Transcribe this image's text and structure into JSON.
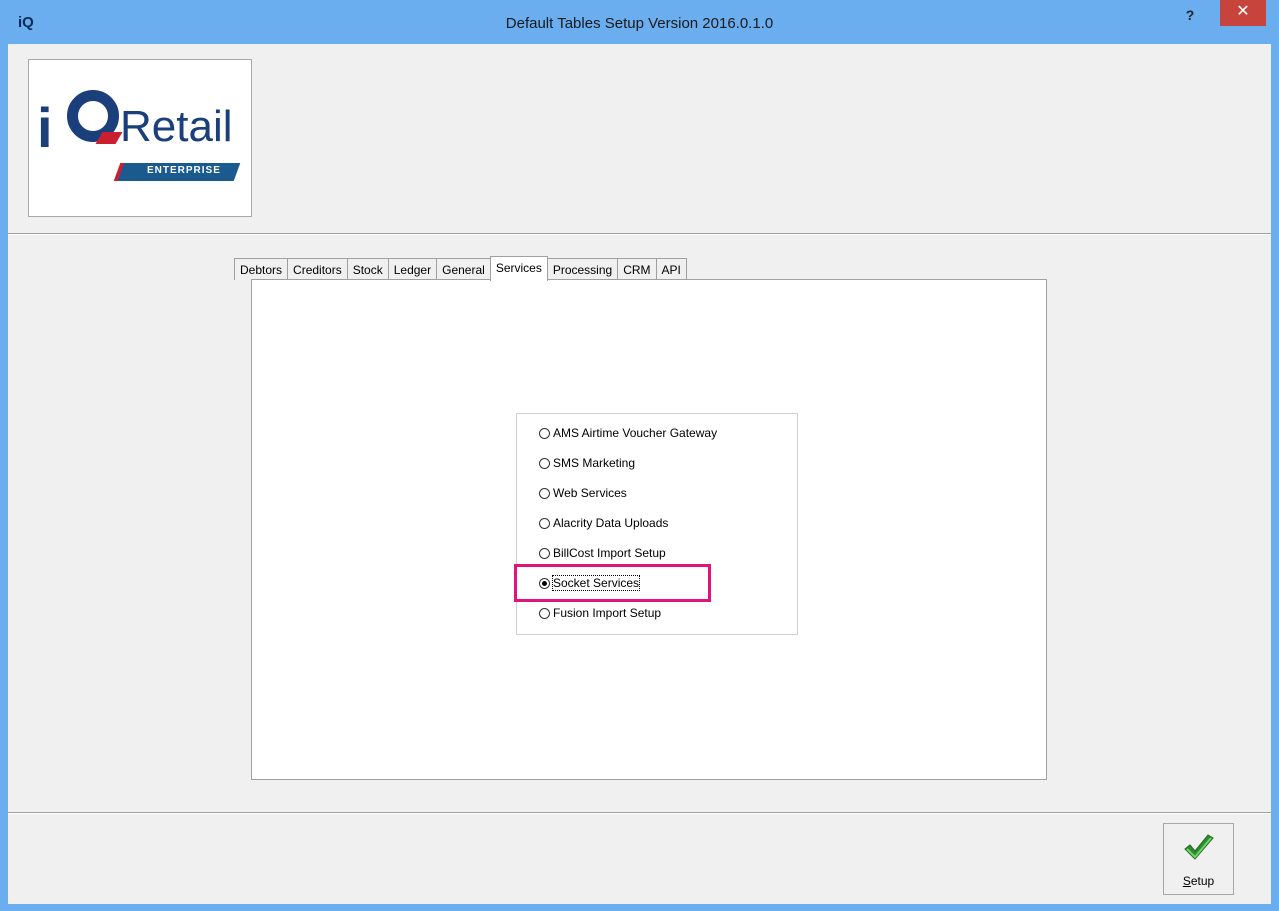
{
  "window": {
    "app_icon_text": "iQ",
    "title": "Default Tables Setup Version 2016.0.1.0",
    "help_label": "?",
    "close_label": "✕"
  },
  "logo": {
    "brand_text": "Retail",
    "sub_text": "ENTERPRISE"
  },
  "tabs": [
    {
      "label": "Debtors"
    },
    {
      "label": "Creditors"
    },
    {
      "label": "Stock"
    },
    {
      "label": "Ledger"
    },
    {
      "label": "General"
    },
    {
      "label": "Services",
      "active": true
    },
    {
      "label": "Processing"
    },
    {
      "label": "CRM"
    },
    {
      "label": "API"
    }
  ],
  "services": {
    "options": [
      {
        "label": "AMS Airtime Voucher Gateway",
        "checked": false
      },
      {
        "label": "SMS Marketing",
        "checked": false
      },
      {
        "label": "Web Services",
        "checked": false
      },
      {
        "label": "Alacrity Data Uploads",
        "checked": false
      },
      {
        "label": "BillCost Import Setup",
        "checked": false
      },
      {
        "label": "Socket Services",
        "checked": true
      },
      {
        "label": "Fusion Import Setup",
        "checked": false
      }
    ]
  },
  "footer": {
    "setup_label_first": "S",
    "setup_label_rest": "etup"
  },
  "colors": {
    "title_bar": "#6aaef0",
    "highlight": "#e0157c",
    "close_button": "#c7443d"
  },
  "icons": {
    "setup": "green-check-icon"
  }
}
